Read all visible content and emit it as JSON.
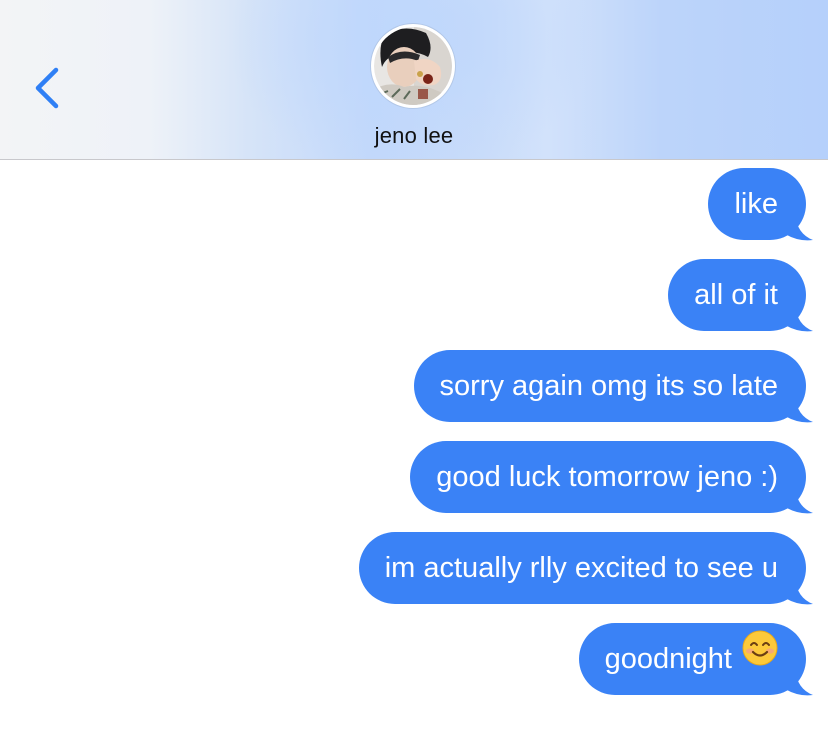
{
  "contact": {
    "name": "jeno lee",
    "avatar_icon": "profile-photo-avatar"
  },
  "nav": {
    "back_icon": "chevron-left-icon"
  },
  "colors": {
    "accent": "#3a82f6",
    "header_gradient_end": "#b5d0fb"
  },
  "messages": [
    {
      "text": "like",
      "sender": "me"
    },
    {
      "text": "all of it",
      "sender": "me"
    },
    {
      "text": "sorry again omg its so late",
      "sender": "me"
    },
    {
      "text": "good luck tomorrow jeno :)",
      "sender": "me"
    },
    {
      "text": "im actually rlly excited to see u",
      "sender": "me"
    },
    {
      "text": "goodnight",
      "sender": "me",
      "emoji": "smiling-face-emoji"
    }
  ]
}
